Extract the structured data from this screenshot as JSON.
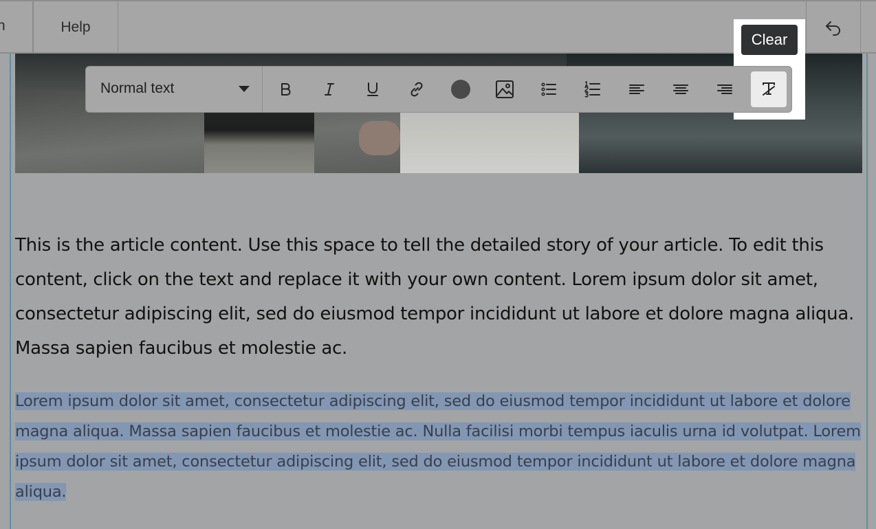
{
  "topbar": {
    "partial_tab_label": "n",
    "help_label": "Help",
    "undo_icon": "undo-icon"
  },
  "toolbar": {
    "text_style": "Normal text",
    "buttons": [
      {
        "name": "bold",
        "icon": "bold-icon"
      },
      {
        "name": "italic",
        "icon": "italic-icon"
      },
      {
        "name": "underline",
        "icon": "underline-icon"
      },
      {
        "name": "link",
        "icon": "link-icon"
      },
      {
        "name": "text-color",
        "icon": "color-circle-icon",
        "color": "#4a4a4a"
      },
      {
        "name": "image",
        "icon": "image-icon"
      },
      {
        "name": "bulleted-list",
        "icon": "bulleted-list-icon"
      },
      {
        "name": "numbered-list",
        "icon": "numbered-list-icon"
      },
      {
        "name": "align-left",
        "icon": "align-left-icon"
      },
      {
        "name": "align-center",
        "icon": "align-center-icon"
      },
      {
        "name": "align-right",
        "icon": "align-right-icon"
      },
      {
        "name": "clear-formatting",
        "icon": "clear-formatting-icon"
      }
    ]
  },
  "tooltip": {
    "label": "Clear"
  },
  "content": {
    "para1": "This is the article content. Use this space to tell the detailed story of your article. To edit this content, click on the text and replace it with your own content. Lorem ipsum dolor sit amet, consectetur adipiscing elit, sed do eiusmod tempor incididunt ut labore et dolore magna aliqua. Massa sapien faucibus et molestie ac.",
    "para2": "Lorem ipsum dolor sit amet, consectetur adipiscing elit, sed do eiusmod tempor incididunt ut labore et dolore magna aliqua. Massa sapien faucibus et molestie ac. Nulla facilisi morbi tempus iaculis urna id volutpat. Lorem ipsum dolor sit amet, consectetur adipiscing elit, sed do eiusmod tempor incididunt ut labore et dolore magna aliqua."
  },
  "colors": {
    "overlay": "#a3a4a6",
    "selection": "#8297b4",
    "tooltip_bg": "#2f3133",
    "canvas_border": "#5d8fa6",
    "spellcheck": "#c0392b"
  }
}
